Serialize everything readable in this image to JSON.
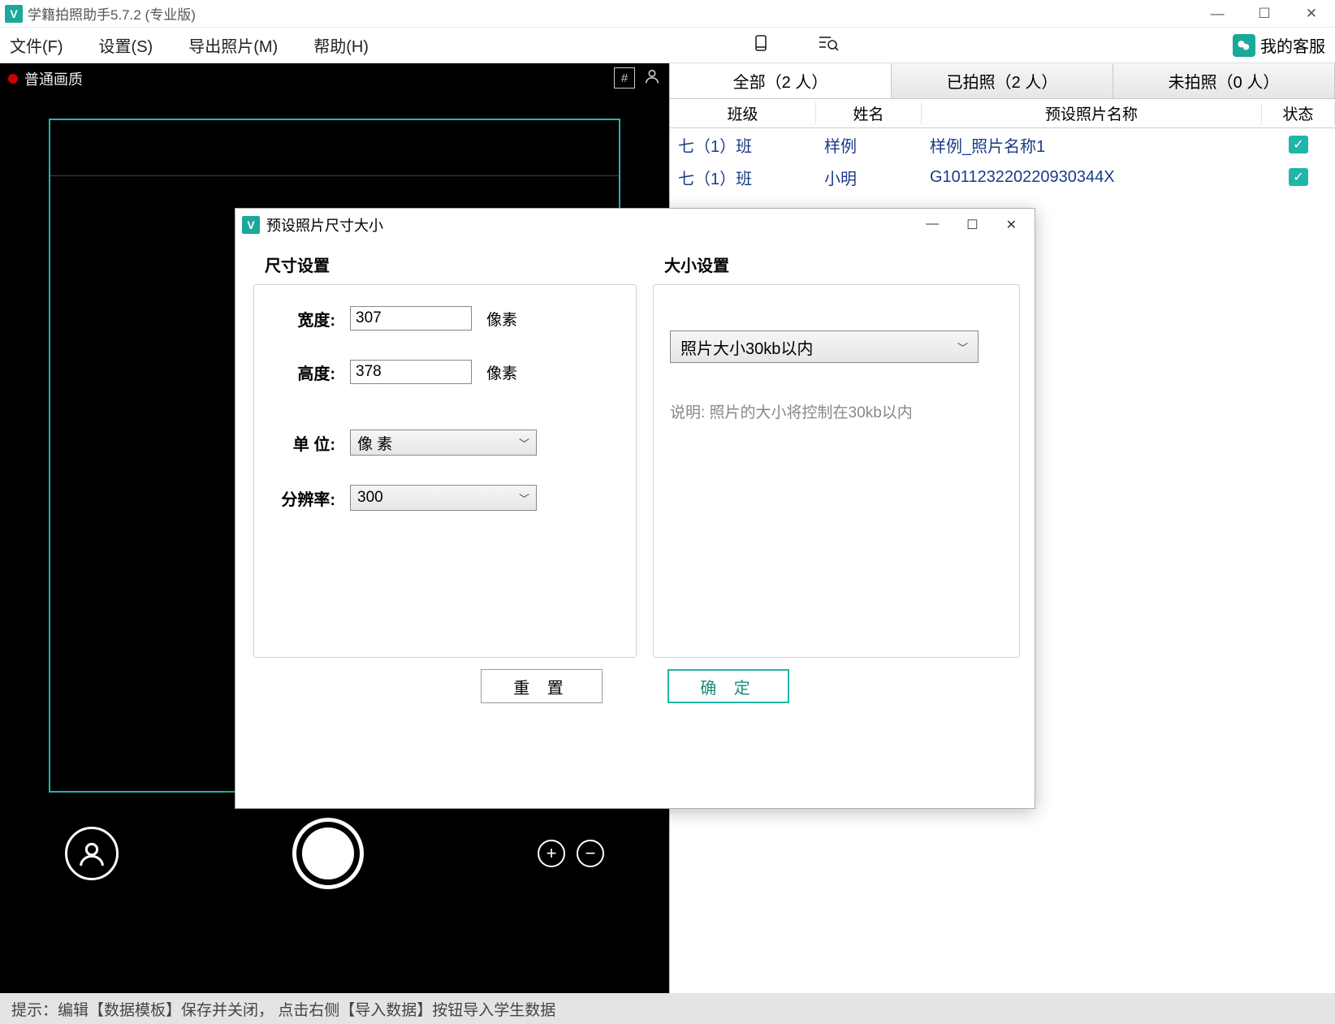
{
  "title": "学籍拍照助手5.7.2 (专业版)",
  "menu": {
    "file": "文件(F)",
    "settings": "设置(S)",
    "export": "导出照片(M)",
    "help": "帮助(H)",
    "kefu": "我的客服"
  },
  "camera": {
    "quality": "普通画质"
  },
  "tabs": {
    "all": "全部（2 人）",
    "taken": "已拍照（2 人）",
    "nottaken": "未拍照（0 人）"
  },
  "table": {
    "headers": {
      "class": "班级",
      "name": "姓名",
      "photo": "预设照片名称",
      "status": "状态"
    },
    "rows": [
      {
        "class": "七（1）班",
        "name": "样例",
        "photo": "样例_照片名称1",
        "checked": true
      },
      {
        "class": "七（1）班",
        "name": "小明",
        "photo": "G101123220220930344X",
        "checked": true
      }
    ]
  },
  "status": "提示：编辑【数据模板】保存并关闭，  点击右侧【导入数据】按钮导入学生数据",
  "dialog": {
    "title": "预设照片尺寸大小",
    "size_group": "尺寸设置",
    "filesize_group": "大小设置",
    "width_label": "宽度:",
    "width_value": "307",
    "px1": "像素",
    "height_label": "高度:",
    "height_value": "378",
    "px2": "像素",
    "unit_label": "单 位:",
    "unit_value": "像 素",
    "res_label": "分辨率:",
    "res_value": "300",
    "filesize_value": "照片大小30kb以内",
    "desc": "说明: 照片的大小将控制在30kb以内",
    "reset": "重 置",
    "ok": "确 定"
  }
}
